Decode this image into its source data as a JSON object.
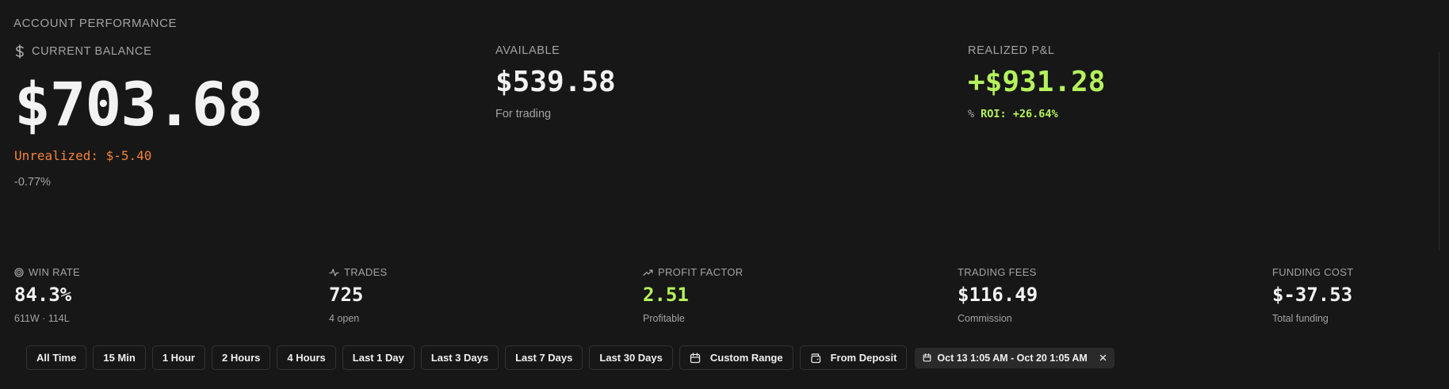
{
  "header": {
    "title": "ACCOUNT PERFORMANCE"
  },
  "balance": {
    "label": "CURRENT BALANCE",
    "value": "$703.68",
    "unrealized": "Unrealized: $-5.40",
    "change_pct": "-0.77%"
  },
  "available": {
    "label": "AVAILABLE",
    "value": "$539.58",
    "sub": "For trading"
  },
  "realized": {
    "label": "REALIZED P&L",
    "value": "+$931.28",
    "roi_icon": "%",
    "roi": "ROI: +26.64%"
  },
  "stats": {
    "win_rate": {
      "label": "WIN RATE",
      "value": "84.3%",
      "sub": "611W · 114L"
    },
    "trades": {
      "label": "TRADES",
      "value": "725",
      "sub": "4 open"
    },
    "profit_factor": {
      "label": "PROFIT FACTOR",
      "value": "2.51",
      "sub": "Profitable"
    },
    "trading_fees": {
      "label": "TRADING FEES",
      "value": "$116.49",
      "sub": "Commission"
    },
    "funding_cost": {
      "label": "FUNDING COST",
      "value": "$-37.53",
      "sub": "Total funding"
    }
  },
  "filters": {
    "all_time": "All Time",
    "min15": "15 Min",
    "hour1": "1 Hour",
    "hours2": "2 Hours",
    "hours4": "4 Hours",
    "day1": "Last 1 Day",
    "days3": "Last 3 Days",
    "days7": "Last 7 Days",
    "days30": "Last 30 Days",
    "custom": "Custom Range",
    "deposit": "From Deposit",
    "active_range": "Oct 13 1:05 AM - Oct 20 1:05 AM"
  },
  "colors": {
    "background": "#171717",
    "positive": "#b5f25c",
    "unrealized": "#f5813a",
    "muted": "#a3a3a3"
  },
  "icons": {
    "balance": "dollar-icon",
    "win_rate": "target-icon",
    "trades": "activity-icon",
    "profit_factor": "trending-up-icon",
    "custom": "calendar-icon",
    "deposit": "wallet-icon",
    "chip": "calendar-icon",
    "clear": "close-icon"
  }
}
